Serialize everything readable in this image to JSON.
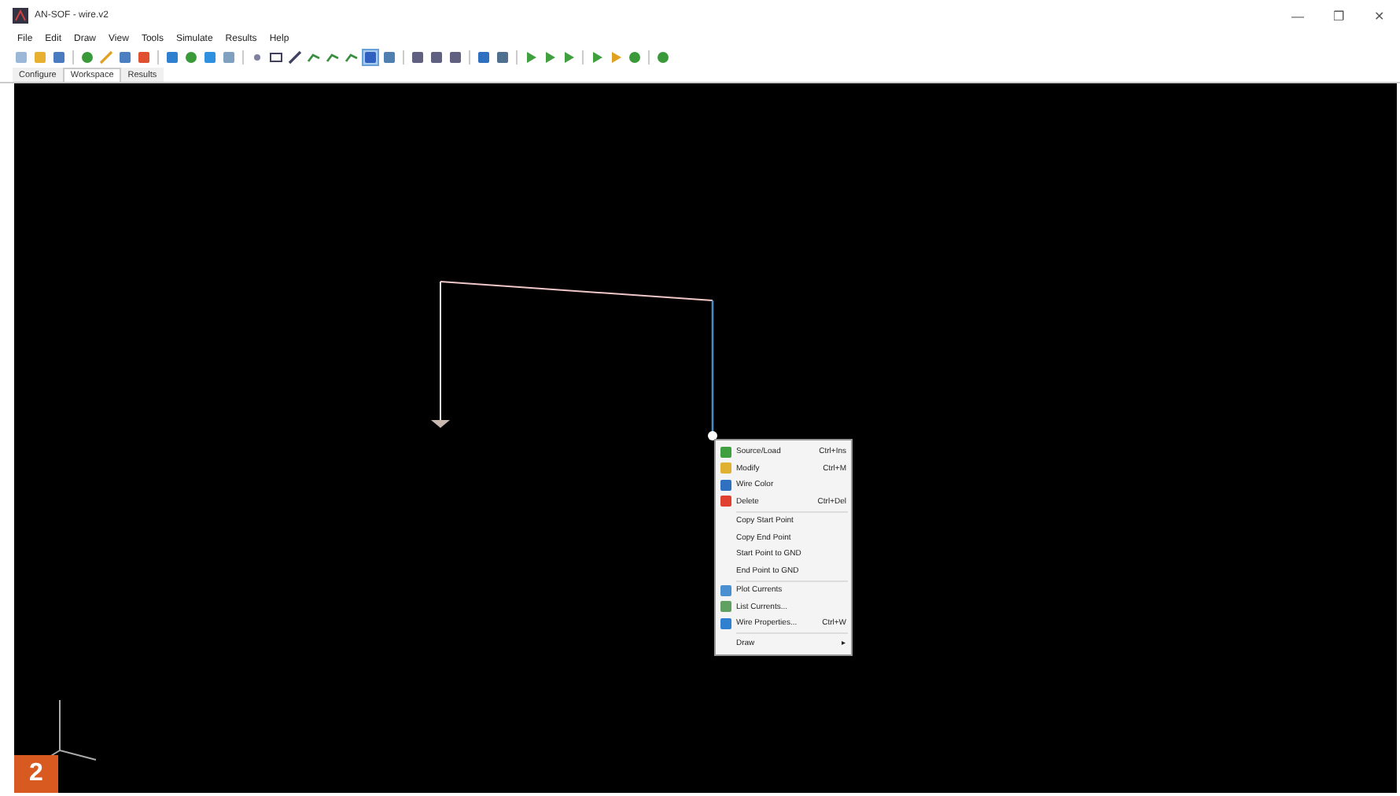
{
  "window": {
    "title": "AN-SOF - wire.v2",
    "controls": [
      "—",
      "❐",
      "✕"
    ]
  },
  "menu_bar": [
    "File",
    "Edit",
    "Draw",
    "View",
    "Tools",
    "Simulate",
    "Results",
    "Help"
  ],
  "toolbar": [
    {
      "selected": false
    },
    {
      "selected": false
    },
    {
      "selected": false
    },
    {
      "selected": false
    },
    {
      "selected": false
    },
    {
      "selected": false
    },
    {
      "selected": false
    },
    {
      "selected": false
    },
    {
      "selected": false
    },
    {
      "selected": false
    },
    {
      "selected": false
    },
    {
      "selected": false
    },
    {
      "selected": false
    },
    {
      "selected": false
    },
    {
      "selected": false
    },
    {
      "selected": false
    },
    {
      "selected": false
    },
    {
      "selected": true
    },
    {
      "selected": false
    },
    {
      "selected": false
    },
    {
      "selected": false
    },
    {
      "selected": false
    },
    {
      "selected": false
    },
    {
      "selected": false
    },
    {
      "selected": false
    },
    {
      "selected": false
    },
    {
      "selected": false
    },
    {
      "selected": false
    },
    {
      "selected": false
    },
    {
      "selected": false
    },
    {
      "selected": false
    }
  ],
  "tabs": [
    {
      "label": "Configure",
      "selected": false
    },
    {
      "label": "Workspace",
      "selected": true
    },
    {
      "label": "Results",
      "selected": false
    }
  ],
  "context_menu": [
    {
      "kind": "item",
      "label": "Source/Load",
      "shortcut": "Ctrl+Ins"
    },
    {
      "kind": "item",
      "label": "Modify",
      "shortcut": "Ctrl+M"
    },
    {
      "kind": "item",
      "label": "Wire Color"
    },
    {
      "kind": "item",
      "label": "Delete",
      "shortcut": "Ctrl+Del"
    },
    {
      "kind": "separator"
    },
    {
      "kind": "item",
      "label": "Copy Start Point"
    },
    {
      "kind": "item",
      "label": "Copy End Point"
    },
    {
      "kind": "item",
      "label": "Start Point to GND"
    },
    {
      "kind": "item",
      "label": "End Point to GND"
    },
    {
      "kind": "separator"
    },
    {
      "kind": "item",
      "label": "Plot Currents"
    },
    {
      "kind": "item",
      "label": "List Currents..."
    },
    {
      "kind": "item",
      "label": "Wire Properties...",
      "shortcut": "Ctrl+W"
    },
    {
      "kind": "separator"
    },
    {
      "kind": "item",
      "label": "Draw",
      "submenu": "▸"
    }
  ],
  "figure_badge": "2"
}
